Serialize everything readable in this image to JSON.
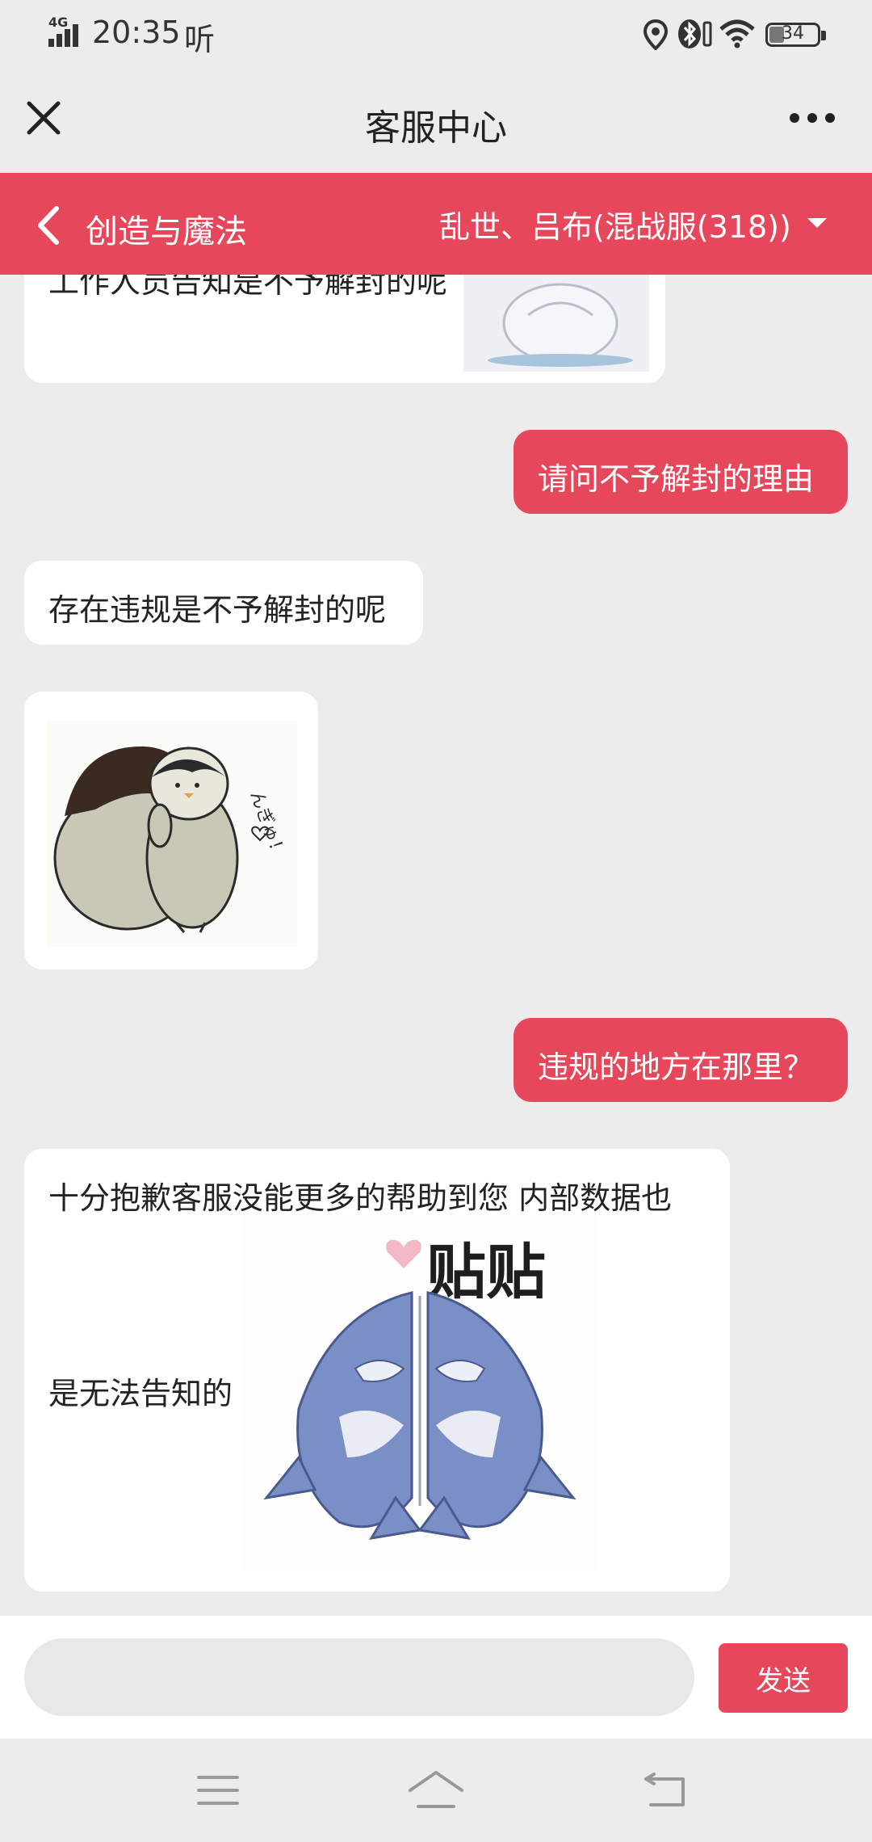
{
  "status_bar": {
    "network": "4G",
    "time": "20:35",
    "extra": "听",
    "battery": "34"
  },
  "header": {
    "title": "客服中心"
  },
  "game_bar": {
    "game": "创造与魔法",
    "server": "乱世、吕布(混战服(318))"
  },
  "messages": {
    "m0_partial": "工作人员告知是不予解封的呢",
    "m1": "请问不予解封的理由",
    "m2": "存在违规是不予解封的呢",
    "m4": "违规的地方在那里？",
    "m5_line1": "十分抱歉客服没能更多的帮助到您 内部数据也",
    "m5_line2": "是无法告知的",
    "sticker_text": "贴贴",
    "penguin_text": "んぎゅ！"
  },
  "input": {
    "placeholder": "",
    "send_label": "发送"
  },
  "colors": {
    "accent": "#e6475a",
    "background": "#ececec"
  }
}
